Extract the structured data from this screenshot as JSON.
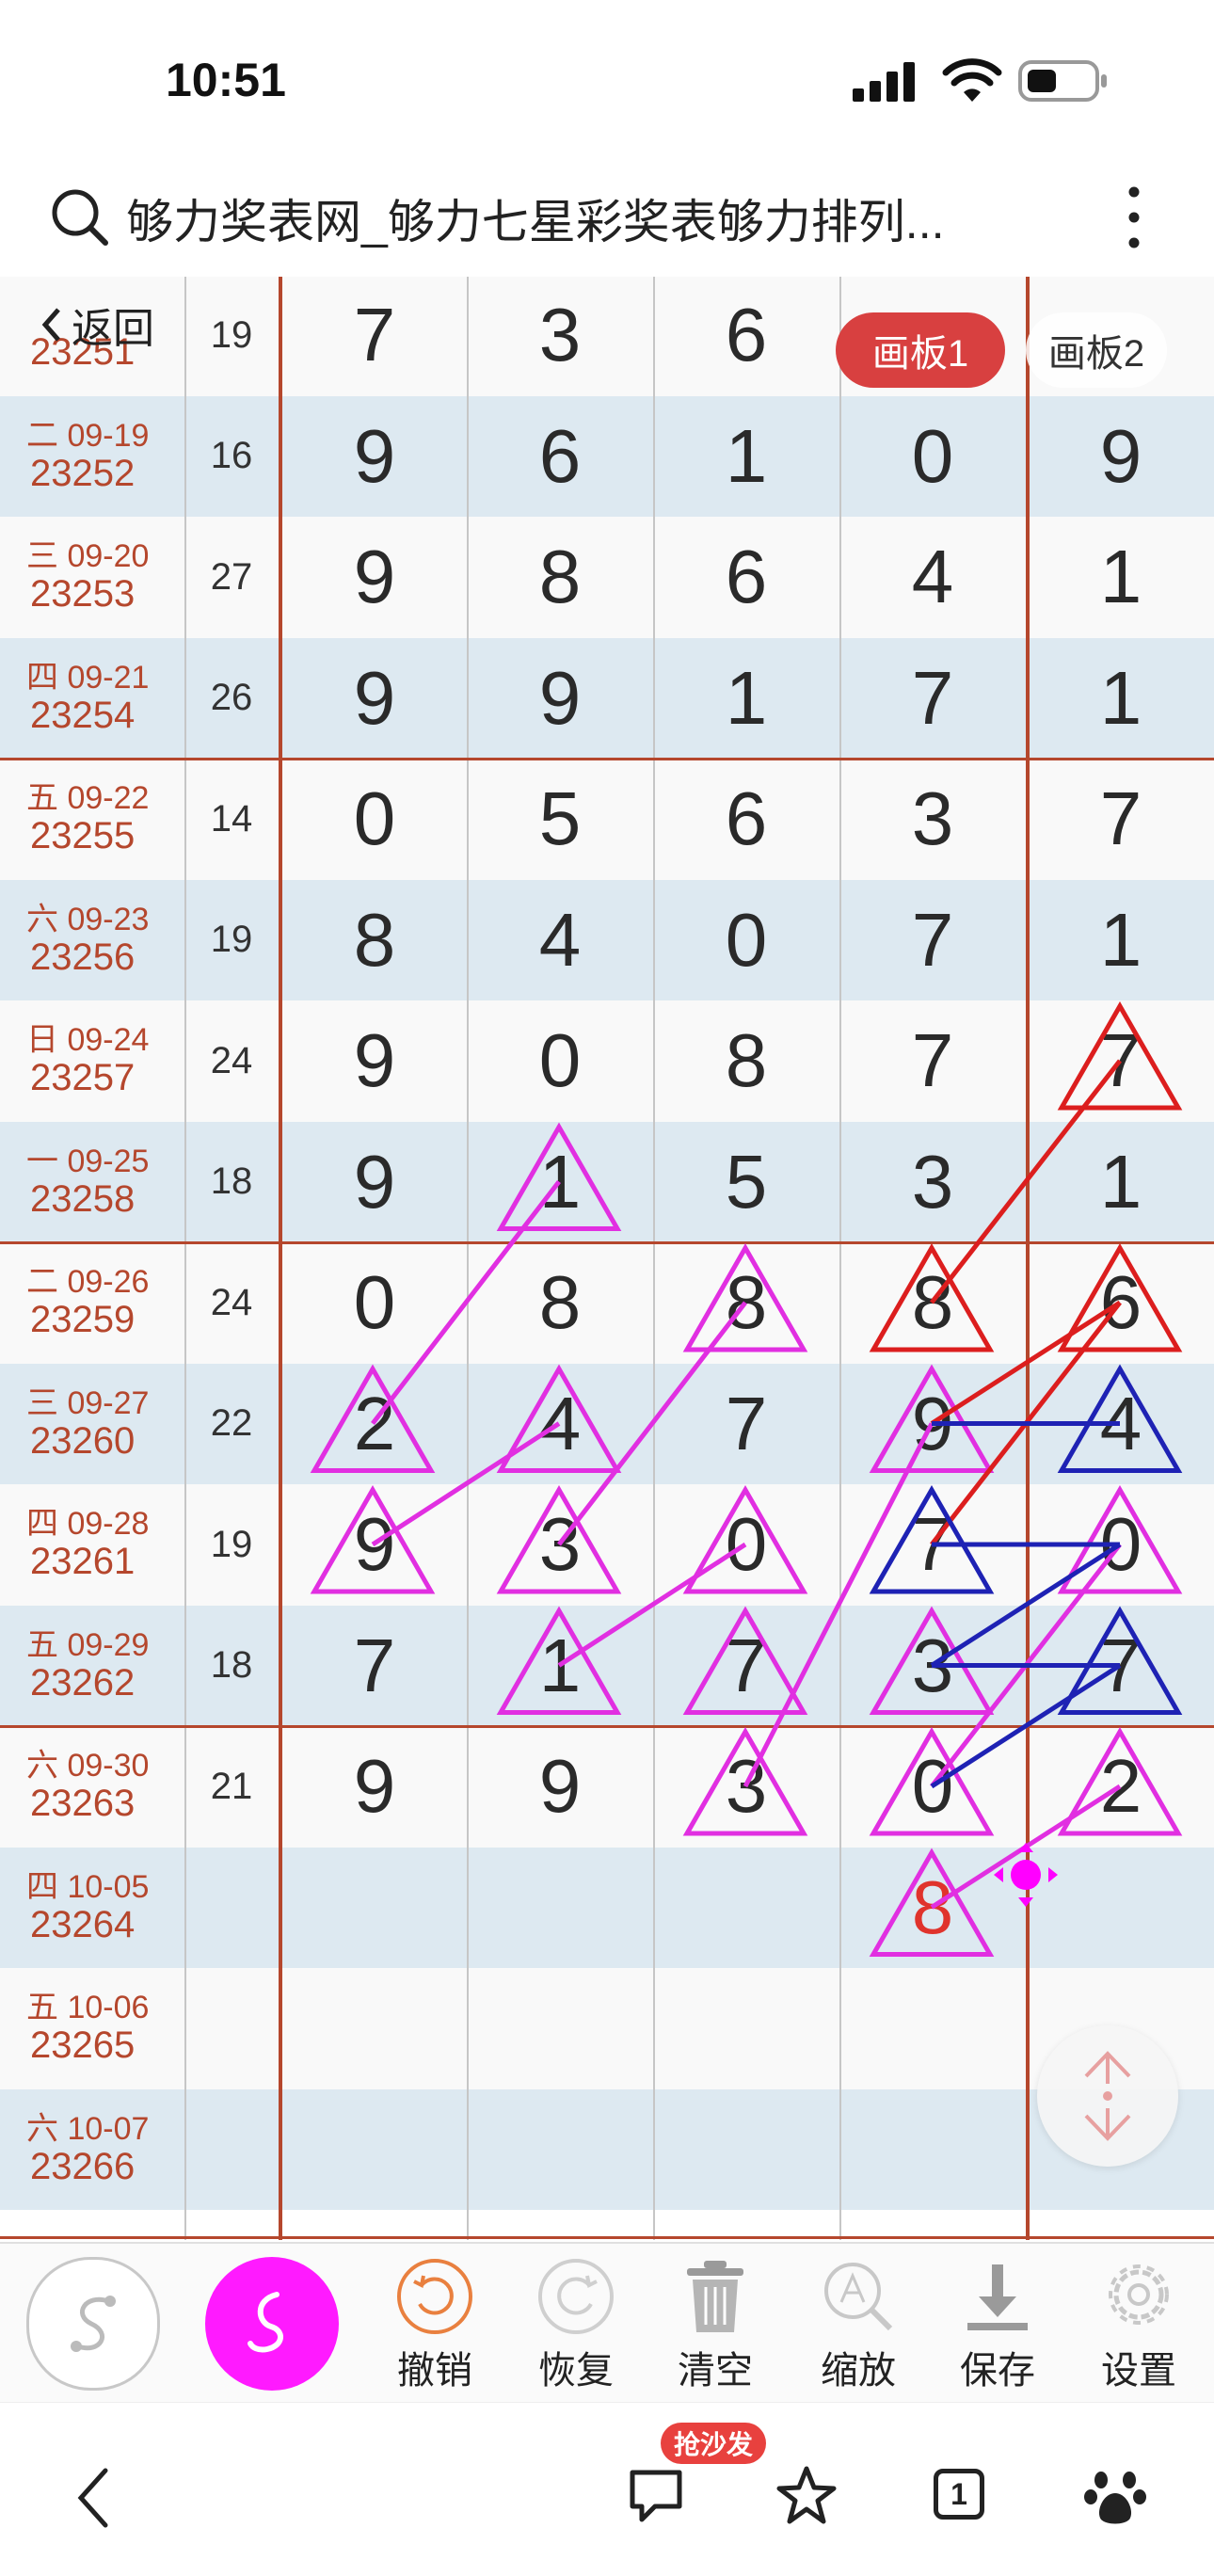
{
  "status_bar": {
    "time": "10:51",
    "icons": [
      "signal-icon",
      "wifi-icon",
      "battery-icon"
    ]
  },
  "browser": {
    "title": "够力奖表网_够力七星彩奖表够力排列...",
    "icons": [
      "search-icon",
      "more-icon"
    ]
  },
  "overlay": {
    "back_label": "返回",
    "board1_label": "画板1",
    "board2_label": "画板2"
  },
  "rows": [
    {
      "date": "",
      "issue": "23251",
      "sum": "19",
      "digits": [
        "7",
        "3",
        "6",
        "",
        ""
      ]
    },
    {
      "date": "二 09-19",
      "issue": "23252",
      "sum": "16",
      "digits": [
        "9",
        "6",
        "1",
        "0",
        "9"
      ]
    },
    {
      "date": "三 09-20",
      "issue": "23253",
      "sum": "27",
      "digits": [
        "9",
        "8",
        "6",
        "4",
        "1"
      ]
    },
    {
      "date": "四 09-21",
      "issue": "23254",
      "sum": "26",
      "digits": [
        "9",
        "9",
        "1",
        "7",
        "1"
      ]
    },
    {
      "date": "五 09-22",
      "issue": "23255",
      "sum": "14",
      "digits": [
        "0",
        "5",
        "6",
        "3",
        "7"
      ]
    },
    {
      "date": "六 09-23",
      "issue": "23256",
      "sum": "19",
      "digits": [
        "8",
        "4",
        "0",
        "7",
        "1"
      ]
    },
    {
      "date": "日 09-24",
      "issue": "23257",
      "sum": "24",
      "digits": [
        "9",
        "0",
        "8",
        "7",
        "7"
      ]
    },
    {
      "date": "一 09-25",
      "issue": "23258",
      "sum": "18",
      "digits": [
        "9",
        "1",
        "5",
        "3",
        "1"
      ]
    },
    {
      "date": "二 09-26",
      "issue": "23259",
      "sum": "24",
      "digits": [
        "0",
        "8",
        "8",
        "8",
        "6"
      ]
    },
    {
      "date": "三 09-27",
      "issue": "23260",
      "sum": "22",
      "digits": [
        "2",
        "4",
        "7",
        "9",
        "4"
      ]
    },
    {
      "date": "四 09-28",
      "issue": "23261",
      "sum": "19",
      "digits": [
        "9",
        "3",
        "0",
        "7",
        "0"
      ]
    },
    {
      "date": "五 09-29",
      "issue": "23262",
      "sum": "18",
      "digits": [
        "7",
        "1",
        "7",
        "3",
        "7"
      ]
    },
    {
      "date": "六 09-30",
      "issue": "23263",
      "sum": "21",
      "digits": [
        "9",
        "9",
        "3",
        "0",
        "2"
      ]
    },
    {
      "date": "四 10-05",
      "issue": "23264",
      "sum": "",
      "digits": [
        "",
        "",
        "",
        "8",
        ""
      ]
    },
    {
      "date": "五 10-06",
      "issue": "23265",
      "sum": "",
      "digits": [
        "",
        "",
        "",
        "",
        ""
      ]
    },
    {
      "date": "六 10-07",
      "issue": "23266",
      "sum": "",
      "digits": [
        "",
        "",
        "",
        "",
        ""
      ]
    }
  ],
  "toolbar": {
    "undo": "撤销",
    "redo": "恢复",
    "clear": "清空",
    "zoom": "缩放",
    "save": "保存",
    "settings": "设置"
  },
  "navbar": {
    "badge": "抢沙发",
    "tab_count": "1"
  },
  "colors": {
    "magenta": "#e12fe1",
    "red": "#dc1e1e",
    "blue": "#1e22b4",
    "accent": "#b5472d",
    "pink_fab": "#ff00ff"
  }
}
